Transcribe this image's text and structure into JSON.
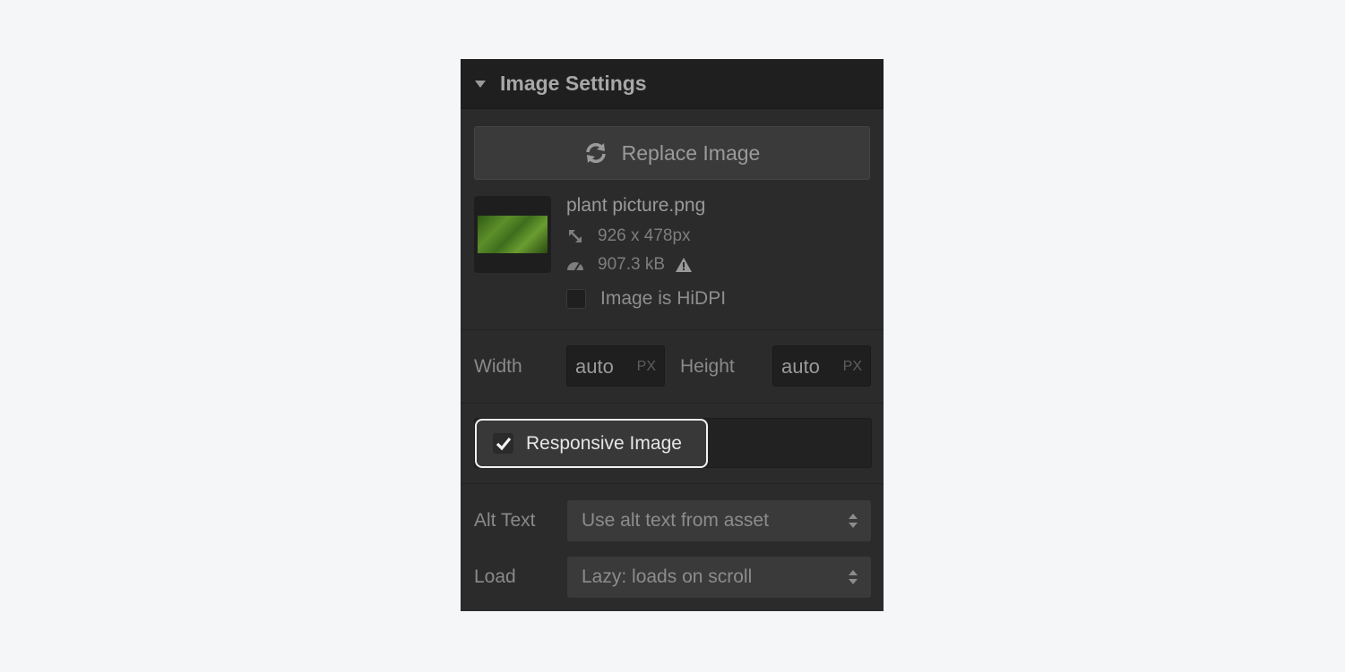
{
  "panel": {
    "title": "Image Settings",
    "replace_button": "Replace Image",
    "file": {
      "name": "plant picture.png",
      "dimensions": "926 x 478px",
      "size": "907.3 kB",
      "hidpi_label": "Image is HiDPI",
      "hidpi_checked": false
    },
    "size_fields": {
      "width_label": "Width",
      "width_value": "auto",
      "width_unit": "PX",
      "height_label": "Height",
      "height_value": "auto",
      "height_unit": "PX"
    },
    "responsive": {
      "label": "Responsive Image",
      "checked": true
    },
    "alt_text": {
      "label": "Alt Text",
      "value": "Use alt text from asset"
    },
    "load": {
      "label": "Load",
      "value": "Lazy: loads on scroll"
    }
  },
  "icons": {
    "collapse": "caret-down-icon",
    "replace": "refresh-icon",
    "dimensions": "resize-arrow-icon",
    "size": "gauge-icon",
    "warning": "warning-icon",
    "check": "checkmark-icon",
    "select": "select-arrows-icon"
  },
  "colors": {
    "page_bg": "#f5f6f8",
    "panel_bg": "#2b2b2b",
    "header_bg": "#1f1f1f",
    "highlight_border": "#f2f2f2"
  }
}
